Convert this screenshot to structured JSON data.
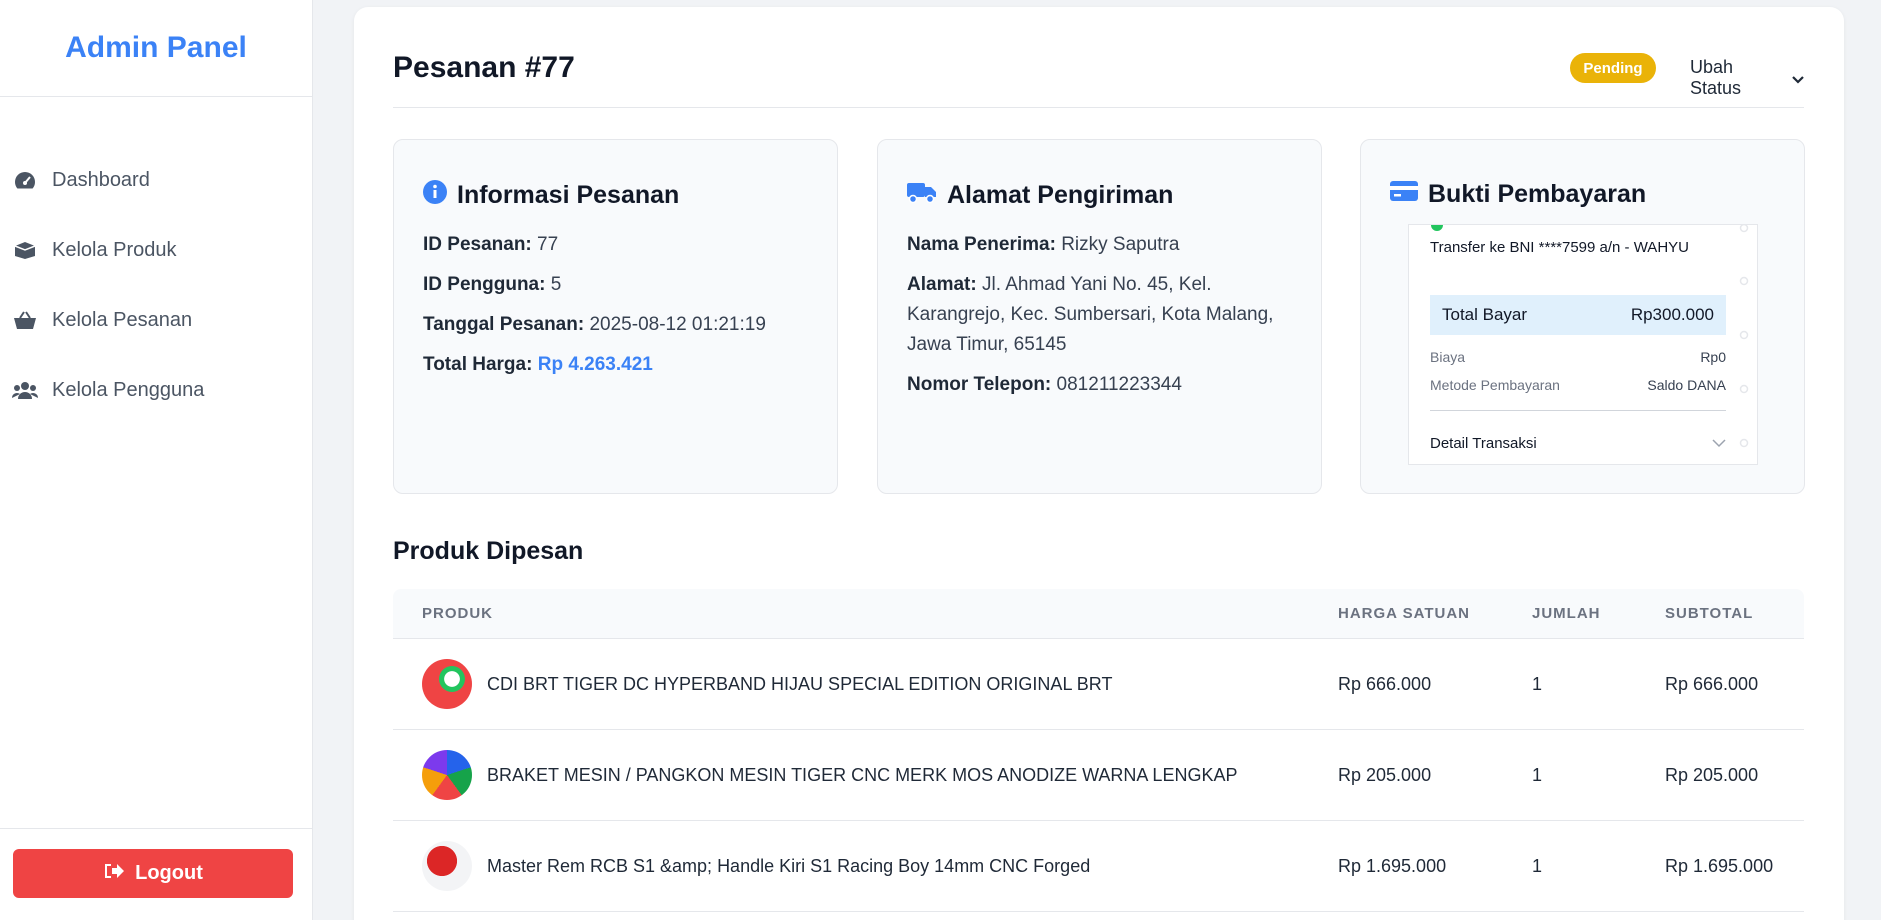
{
  "sidebar": {
    "brand": "Admin Panel",
    "items": [
      {
        "label": "Dashboard",
        "icon": "gauge-icon"
      },
      {
        "label": "Kelola Produk",
        "icon": "box-icon"
      },
      {
        "label": "Kelola Pesanan",
        "icon": "basket-icon"
      },
      {
        "label": "Kelola Pengguna",
        "icon": "users-icon"
      }
    ],
    "logout_label": "Logout"
  },
  "header": {
    "title": "Pesanan #77",
    "status_badge": "Pending",
    "change_status_label": "Ubah Status"
  },
  "order_info": {
    "title": "Informasi Pesanan",
    "id_label": "ID Pesanan:",
    "id_value": "77",
    "user_label": "ID Pengguna:",
    "user_value": "5",
    "date_label": "Tanggal Pesanan:",
    "date_value": "2025-08-12 01:21:19",
    "total_label": "Total Harga:",
    "total_value": "Rp 4.263.421"
  },
  "shipping": {
    "title": "Alamat Pengiriman",
    "recipient_label": "Nama Penerima:",
    "recipient_value": "Rizky Saputra",
    "address_label": "Alamat:",
    "address_value": "Jl. Ahmad Yani No. 45, Kel. Karangrejo, Kec. Sumbersari, Kota Malang, Jawa Timur, 65145",
    "phone_label": "Nomor Telepon:",
    "phone_value": "081211223344"
  },
  "payment": {
    "title": "Bukti Pembayaran",
    "transfer_text": "Transfer ke BNI ****7599 a/n - WAHYU",
    "total_label": "Total Bayar",
    "total_value": "Rp300.000",
    "fee_label": "Biaya",
    "fee_value": "Rp0",
    "method_label": "Metode Pembayaran",
    "method_value": "Saldo DANA",
    "detail_label": "Detail Transaksi"
  },
  "products": {
    "title": "Produk Dipesan",
    "columns": [
      "PRODUK",
      "HARGA SATUAN",
      "JUMLAH",
      "SUBTOTAL"
    ],
    "rows": [
      {
        "name": "CDI BRT TIGER DC HYPERBAND HIJAU SPECIAL EDITION ORIGINAL BRT",
        "price": "Rp 666.000",
        "qty": "1",
        "subtotal": "Rp 666.000"
      },
      {
        "name": "BRAKET MESIN / PANGKON MESIN TIGER CNC MERK MOS ANODIZE WARNA LENGKAP",
        "price": "Rp 205.000",
        "qty": "1",
        "subtotal": "Rp 205.000"
      },
      {
        "name": "Master Rem RCB S1 &amp; Handle Kiri S1 Racing Boy 14mm CNC Forged",
        "price": "Rp 1.695.000",
        "qty": "1",
        "subtotal": "Rp 1.695.000"
      }
    ]
  },
  "colors": {
    "accent": "#3b82f6",
    "danger": "#ef4444",
    "pending": "#eab308"
  }
}
